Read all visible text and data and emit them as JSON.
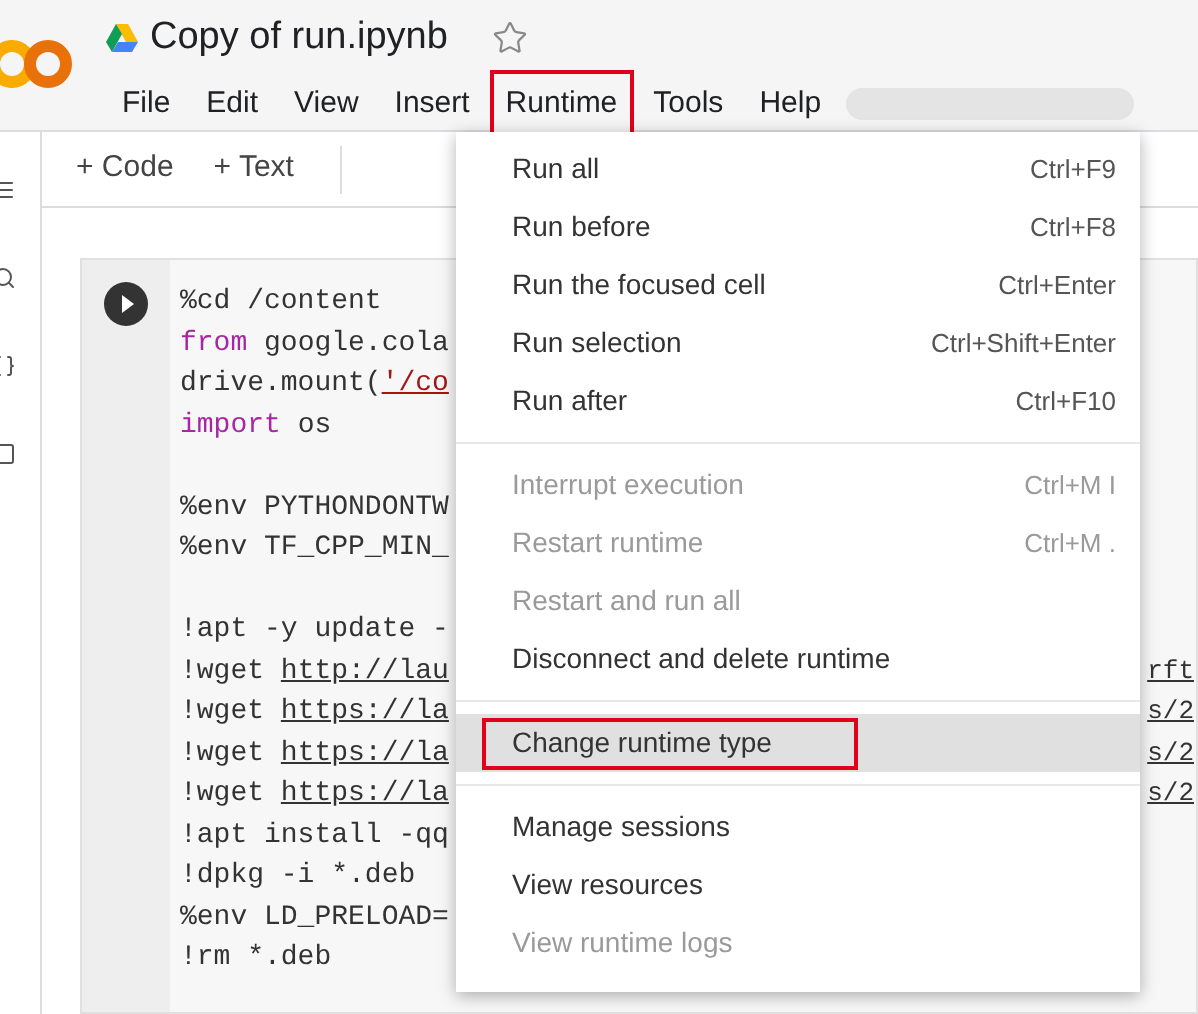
{
  "notebook": {
    "title": "Copy of run.ipynb",
    "starred": false
  },
  "menu_bar": [
    {
      "label": "File",
      "selected": false,
      "annotated": false
    },
    {
      "label": "Edit",
      "selected": false,
      "annotated": false
    },
    {
      "label": "View",
      "selected": false,
      "annotated": false
    },
    {
      "label": "Insert",
      "selected": false,
      "annotated": false
    },
    {
      "label": "Runtime",
      "selected": true,
      "annotated": true
    },
    {
      "label": "Tools",
      "selected": false,
      "annotated": false
    },
    {
      "label": "Help",
      "selected": false,
      "annotated": false
    }
  ],
  "toolbar": [
    {
      "label": "+ Code"
    },
    {
      "label": "+ Text"
    }
  ],
  "code_cell": {
    "blocks": [
      [
        {
          "segments": [
            {
              "kind": "plain",
              "text": "%cd /content"
            }
          ]
        },
        {
          "segments": [
            {
              "kind": "keyword",
              "text": "from"
            },
            {
              "kind": "plain",
              "text": " google.cola"
            }
          ]
        },
        {
          "segments": [
            {
              "kind": "plain",
              "text": "drive.mount("
            },
            {
              "kind": "string",
              "text": "'/co"
            }
          ]
        },
        {
          "segments": [
            {
              "kind": "keyword",
              "text": "import"
            },
            {
              "kind": "plain",
              "text": " os"
            }
          ]
        }
      ],
      [
        {
          "segments": [
            {
              "kind": "plain",
              "text": "%env PYTHONDONTW"
            }
          ]
        },
        {
          "segments": [
            {
              "kind": "plain",
              "text": "%env TF_CPP_MIN_"
            }
          ]
        }
      ],
      [
        {
          "segments": [
            {
              "kind": "plain",
              "text": "!apt -y update -"
            }
          ]
        },
        {
          "segments": [
            {
              "kind": "plain",
              "text": "!wget "
            },
            {
              "kind": "link",
              "text": "http://lau"
            }
          ],
          "right": "rft"
        },
        {
          "segments": [
            {
              "kind": "plain",
              "text": "!wget "
            },
            {
              "kind": "link",
              "text": "https://la"
            }
          ],
          "right": "s/2"
        },
        {
          "segments": [
            {
              "kind": "plain",
              "text": "!wget "
            },
            {
              "kind": "link",
              "text": "https://la"
            }
          ],
          "right": "s/2"
        },
        {
          "segments": [
            {
              "kind": "plain",
              "text": "!wget "
            },
            {
              "kind": "link",
              "text": "https://la"
            }
          ],
          "right": "s/2"
        },
        {
          "segments": [
            {
              "kind": "plain",
              "text": "!apt install -qq"
            }
          ]
        },
        {
          "segments": [
            {
              "kind": "plain",
              "text": "!dpkg -i *.deb"
            }
          ]
        },
        {
          "segments": [
            {
              "kind": "plain",
              "text": "%env LD_PRELOAD="
            }
          ]
        },
        {
          "segments": [
            {
              "kind": "plain",
              "text": "!rm *.deb"
            }
          ]
        }
      ]
    ]
  },
  "runtime_menu": {
    "groups": [
      [
        {
          "label": "Run all",
          "shortcut": "Ctrl+F9",
          "disabled": false,
          "selected": false,
          "annotated": false
        },
        {
          "label": "Run before",
          "shortcut": "Ctrl+F8",
          "disabled": false,
          "selected": false,
          "annotated": false
        },
        {
          "label": "Run the focused cell",
          "shortcut": "Ctrl+Enter",
          "disabled": false,
          "selected": false,
          "annotated": false
        },
        {
          "label": "Run selection",
          "shortcut": "Ctrl+Shift+Enter",
          "disabled": false,
          "selected": false,
          "annotated": false
        },
        {
          "label": "Run after",
          "shortcut": "Ctrl+F10",
          "disabled": false,
          "selected": false,
          "annotated": false
        }
      ],
      [
        {
          "label": "Interrupt execution",
          "shortcut": "Ctrl+M I",
          "disabled": true,
          "selected": false,
          "annotated": false
        },
        {
          "label": "Restart runtime",
          "shortcut": "Ctrl+M .",
          "disabled": true,
          "selected": false,
          "annotated": false
        },
        {
          "label": "Restart and run all",
          "disabled": true,
          "selected": false,
          "annotated": false
        },
        {
          "label": "Disconnect and delete runtime",
          "disabled": false,
          "selected": false,
          "annotated": false
        }
      ],
      [
        {
          "label": "Change runtime type",
          "disabled": false,
          "selected": true,
          "annotated": true
        }
      ],
      [
        {
          "label": "Manage sessions",
          "disabled": false,
          "selected": false,
          "annotated": false
        },
        {
          "label": "View resources",
          "disabled": false,
          "selected": false,
          "annotated": false
        },
        {
          "label": "View runtime logs",
          "disabled": true,
          "selected": false,
          "annotated": false
        }
      ]
    ]
  }
}
